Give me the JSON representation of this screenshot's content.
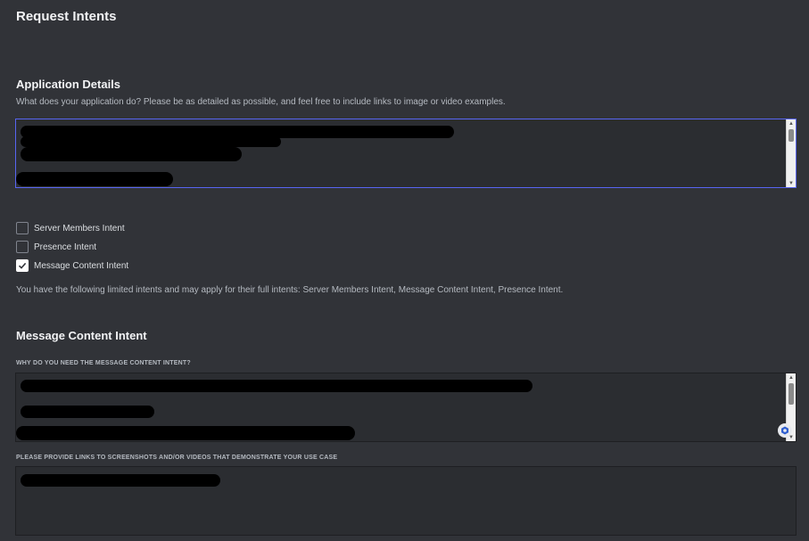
{
  "page": {
    "title": "Request Intents"
  },
  "application_details": {
    "heading": "Application Details",
    "description": "What does your application do? Please be as detailed as possible, and feel free to include links to image or video examples."
  },
  "intents": {
    "items": [
      {
        "label": "Server Members Intent",
        "checked": false
      },
      {
        "label": "Presence Intent",
        "checked": false
      },
      {
        "label": "Message Content Intent",
        "checked": true
      }
    ],
    "note": "You have the following limited intents and may apply for their full intents: Server Members Intent, Message Content Intent, Presence Intent."
  },
  "message_content": {
    "heading": "Message Content Intent",
    "why_label": "WHY DO YOU NEED THE MESSAGE CONTENT INTENT?",
    "links_label": "PLEASE PROVIDE LINKS TO SCREENSHOTS AND/OR VIDEOS THAT DEMONSTRATE YOUR USE CASE"
  },
  "colors": {
    "background": "#313338",
    "input_bg": "#2b2d31",
    "focus_border": "#5865f2",
    "text": "#dbdee1",
    "heading": "#f2f3f5"
  },
  "icons": {
    "checkbox_check": "check-icon",
    "scroll_up": "scroll-up-arrow-icon",
    "scroll_down": "scroll-down-arrow-icon",
    "extension": "grammar-extension-icon"
  }
}
